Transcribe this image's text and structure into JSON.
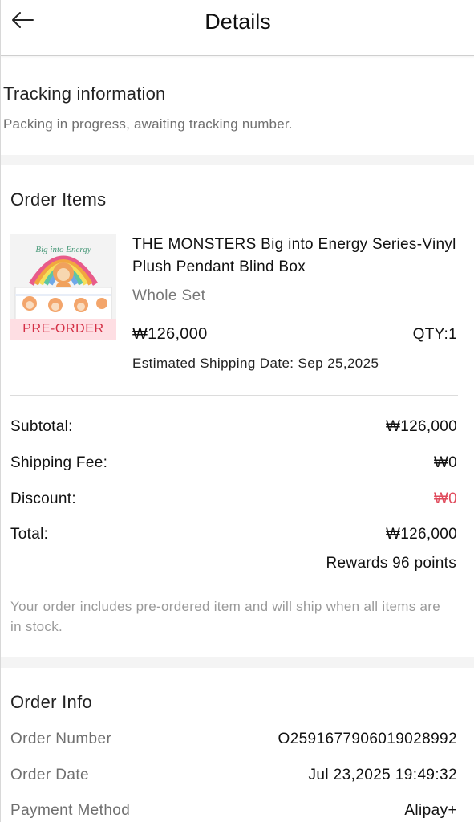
{
  "header": {
    "title": "Details",
    "back_icon": "arrow-left-icon"
  },
  "tracking": {
    "title": "Tracking information",
    "status": "Packing in progress, awaiting tracking number."
  },
  "order_items": {
    "title": "Order Items",
    "items": [
      {
        "thumbnail": "product-image",
        "thumbnail_text": "Big into Energy",
        "tag": "PRE-ORDER",
        "name": "THE MONSTERS Big into Energy Series-Vinyl Plush Pendant Blind Box",
        "variant": "Whole Set",
        "price": "₩126,000",
        "qty": "QTY:1",
        "estimated_shipping": "Estimated Shipping Date: Sep 25,2025"
      }
    ]
  },
  "summary": {
    "subtotal_label": "Subtotal:",
    "subtotal_value": "₩126,000",
    "shipping_label": "Shipping Fee:",
    "shipping_value": "₩0",
    "discount_label": "Discount:",
    "discount_value": "₩0",
    "total_label": "Total:",
    "total_value": "₩126,000",
    "rewards": "Rewards 96 points",
    "note": "Your order includes pre-ordered item and will ship when all items are in stock."
  },
  "order_info": {
    "title": "Order Info",
    "rows": [
      {
        "label": "Order Number",
        "value": "O2591677906019028992"
      },
      {
        "label": "Order Date",
        "value": "Jul 23,2025 19:49:32"
      },
      {
        "label": "Payment Method",
        "value": "Alipay+"
      }
    ]
  },
  "colors": {
    "accent_red": "#e04a5c",
    "preorder_red": "#d42f45",
    "secondary_text": "#707070",
    "section_gap": "#f4f4f4"
  }
}
